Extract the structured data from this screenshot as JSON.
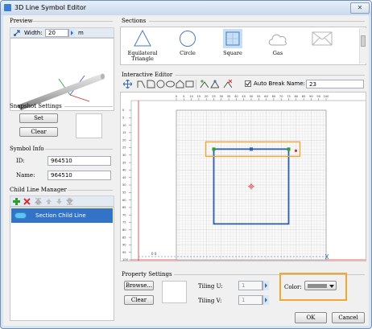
{
  "window": {
    "title": "3D Line Symbol Editor",
    "close_glyph": "✕"
  },
  "preview": {
    "section_label": "Preview",
    "width_label": "Width:",
    "width_value": "20",
    "width_unit": "m"
  },
  "snapshot": {
    "section_label": "Snapshot Settings",
    "set_label": "Set",
    "clear_label": "Clear"
  },
  "symbol_info": {
    "section_label": "Symbol Info",
    "id_label": "ID:",
    "id_value": "964510",
    "name_label": "Name:",
    "name_value": "964510"
  },
  "child_line": {
    "section_label": "Child Line Manager",
    "items": [
      {
        "label": "Section Child Line"
      }
    ]
  },
  "sections": {
    "section_label": "Sections",
    "items": [
      {
        "label": "Equilateral Triangle",
        "icon": "triangle-icon"
      },
      {
        "label": "Circle",
        "icon": "circle-icon"
      },
      {
        "label": "Square",
        "icon": "square-icon",
        "selected": true
      },
      {
        "label": "Gas",
        "icon": "cloud-icon"
      },
      {
        "label": "",
        "icon": "envelope-icon"
      }
    ]
  },
  "editor": {
    "section_label": "Interactive Editor",
    "auto_break_label": "Auto Break",
    "auto_break_checked": true,
    "name_label": "Name:",
    "name_value": "23",
    "ruler_top": [
      "0",
      "5",
      "10",
      "15",
      "20",
      "25",
      "30",
      "35",
      "40",
      "45",
      "50",
      "55",
      "60",
      "65",
      "70",
      "75",
      "80",
      "85",
      "90",
      "95",
      "100"
    ],
    "ruler_left": [
      "0",
      "5",
      "10",
      "15",
      "20",
      "25",
      "30",
      "35",
      "40",
      "45",
      "50",
      "55",
      "60",
      "65",
      "70",
      "75",
      "80",
      "85",
      "90",
      "95",
      "100"
    ],
    "corner_label": "0 0",
    "colors": {
      "shape": "#2c5fa8",
      "highlight": "#f0a830",
      "axis": "#d83030"
    }
  },
  "property": {
    "section_label": "Property Settings",
    "browse_label": "Browse...",
    "clear_label": "Clear",
    "tiling_u_label": "Tiling U:",
    "tiling_u_value": "1",
    "tiling_v_label": "Tiling V:",
    "tiling_v_value": "1",
    "color_label": "Color:",
    "color_value": "#8c8c8c"
  },
  "footer": {
    "ok_label": "OK",
    "cancel_label": "Cancel"
  }
}
